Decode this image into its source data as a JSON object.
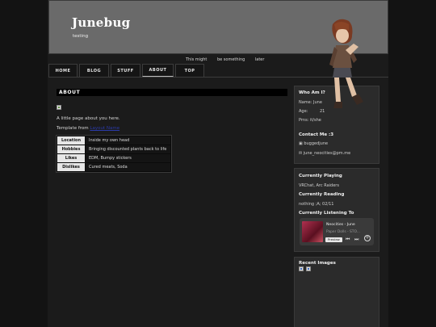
{
  "site": {
    "title": "Junebug",
    "tagline": "testing"
  },
  "marquee": [
    "This might",
    "be something",
    "later"
  ],
  "nav": [
    "HOME",
    "BLOG",
    "STUFF",
    "ABOUT",
    "TOP"
  ],
  "active_tab": "ABOUT",
  "main": {
    "heading": "ABOUT",
    "intro": "A little page about you here.",
    "template_prefix": "Template from",
    "template_link": "Layout Name",
    "table": [
      {
        "label": "Location",
        "value": "Inside my own head"
      },
      {
        "label": "Hobbies",
        "value": "Bringing discounted plants back to life"
      },
      {
        "label": "Likes",
        "value": "EDM, Bumpy stickers"
      },
      {
        "label": "Dislikes",
        "value": "Cured meats, Soda"
      }
    ]
  },
  "sidebar": {
    "who": {
      "title": "Who Am I?",
      "name": "Name: June",
      "age_label": "Age:",
      "age_value": "21",
      "prns": "Prns: it/she"
    },
    "contact": {
      "title": "Contact Me :3",
      "discord": "buggedjune",
      "email": "june_neocities@pm.me"
    },
    "playing": {
      "title": "Currently Playing",
      "value": "VRChat, Arc Raiders"
    },
    "reading": {
      "title": "Currently Reading",
      "value": "nothing ;A; 02/11"
    },
    "listening": {
      "title": "Currently Listening To",
      "track": "Neocities - June",
      "sub": "Paper Dolls - STO...",
      "preview": "Preview"
    },
    "recent": {
      "title": "Recent Images"
    }
  },
  "colors": {
    "accent": "#6a6a6a",
    "link": "#2a3aa8",
    "background": "#131313"
  }
}
